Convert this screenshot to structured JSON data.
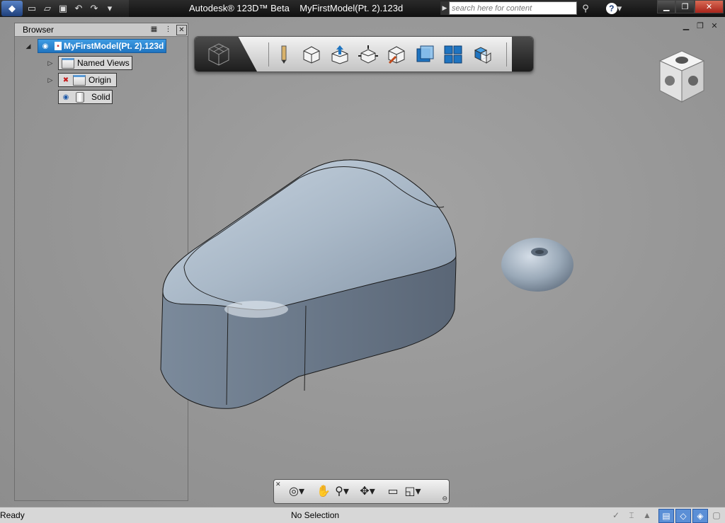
{
  "titlebar": {
    "title": "Autodesk® 123D™ Beta    MyFirstModel(Pt. 2).123d",
    "search_placeholder": "search here for content",
    "window_buttons": [
      "minimize",
      "restore",
      "close"
    ]
  },
  "quick_access": [
    "app-menu-icon",
    "new-icon",
    "open-icon",
    "save-icon",
    "undo-icon",
    "redo-icon",
    "customize-icon"
  ],
  "browser": {
    "title": "Browser",
    "root_label": "MyFirstModel(Pt. 2).123d",
    "items": [
      {
        "label": "Named Views"
      },
      {
        "label": "Origin"
      },
      {
        "label": "Solid"
      }
    ]
  },
  "toolbar": {
    "tools": [
      "sketch-icon",
      "primitives-icon",
      "construct-icon",
      "modify-icon",
      "inspect-icon",
      "view-mode-icon",
      "grid-icon",
      "box-icon"
    ]
  },
  "navbar": {
    "tools": [
      "orbit-icon",
      "pan-icon",
      "zoom-icon",
      "steering-icon",
      "fit-icon",
      "view-cube-icon"
    ]
  },
  "status": {
    "left": "Ready",
    "center": "No Selection"
  },
  "colors": {
    "accent": "#1f74c0",
    "viewport_bg": "#9b9b9b",
    "model_color": "#8fa0b2"
  }
}
